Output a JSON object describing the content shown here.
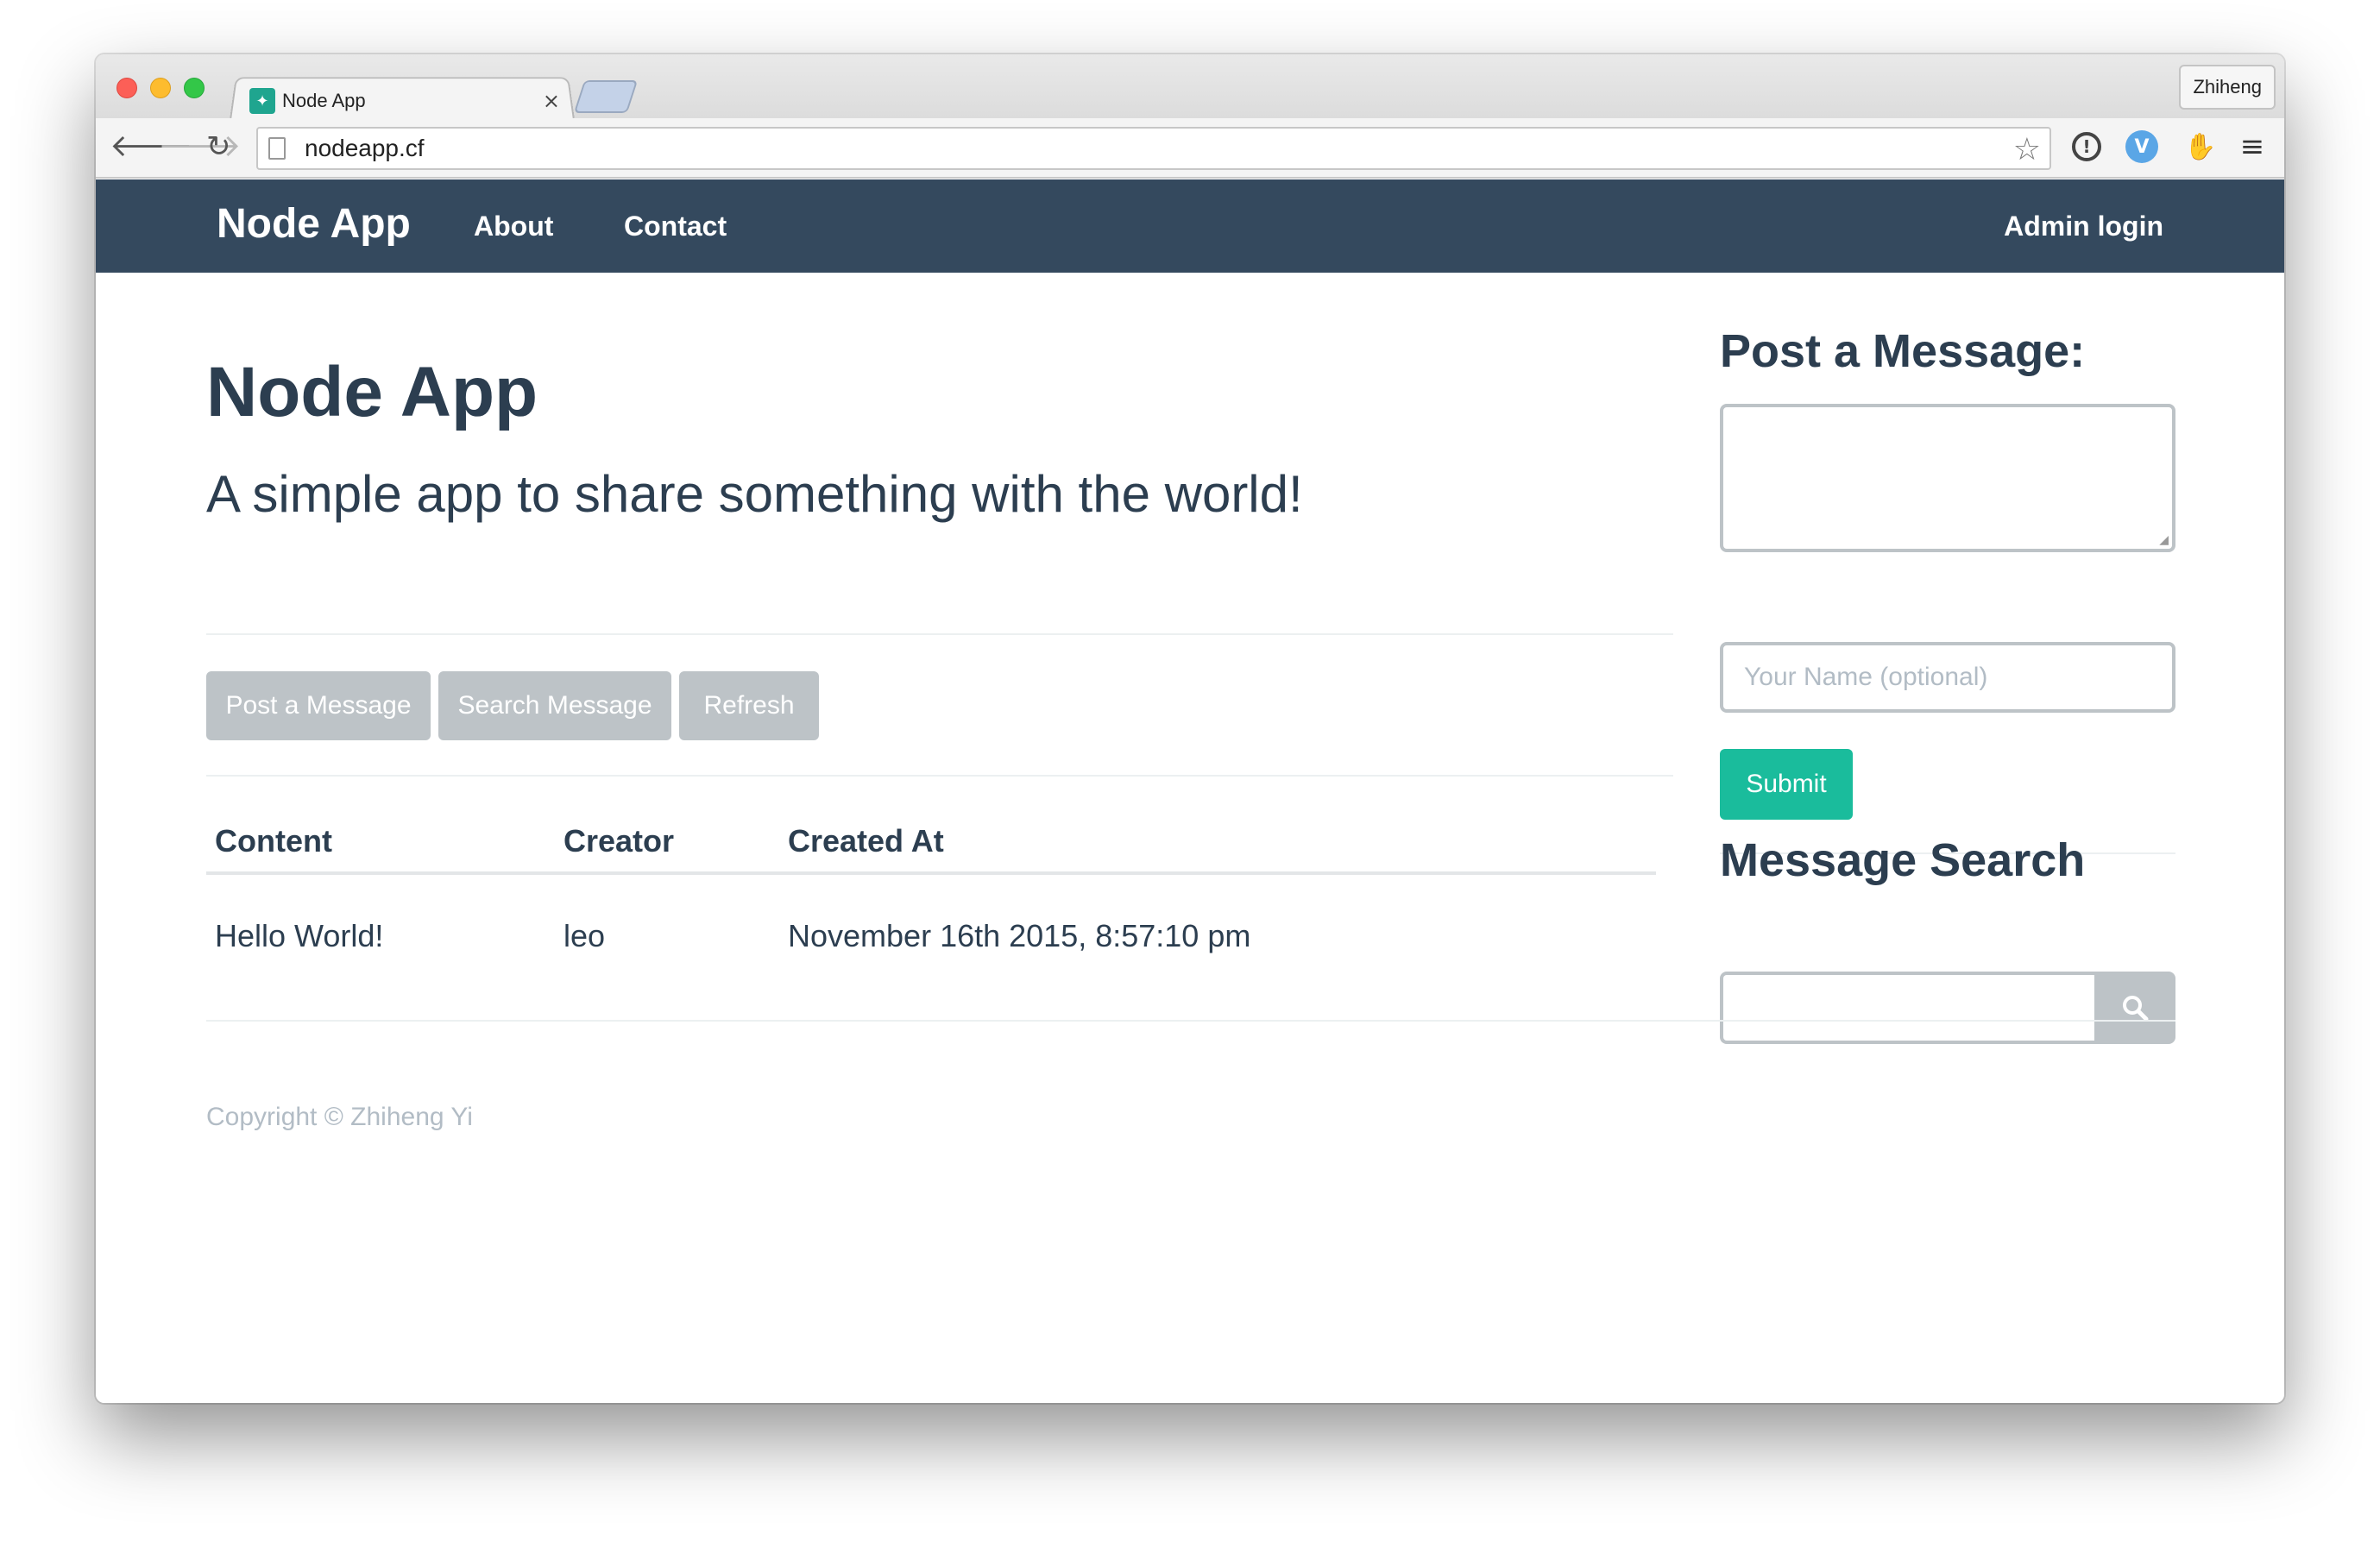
{
  "browser": {
    "tab_title": "Node App",
    "tab_close": "×",
    "profile_name": "Zhiheng",
    "url": "nodeapp.cf",
    "icons": {
      "back": "arrow-left-icon",
      "forward": "arrow-right-icon",
      "reload": "reload-icon",
      "star": "star-icon",
      "menu": "hamburger-menu-icon"
    }
  },
  "navbar": {
    "brand": "Node App",
    "links": {
      "about": "About",
      "contact": "Contact",
      "admin": "Admin login"
    },
    "background": "#34495e"
  },
  "main": {
    "title": "Node App",
    "tagline": "A simple app to share something with the world!",
    "buttons": {
      "post": "Post a Message",
      "search": "Search Message",
      "refresh": "Refresh"
    },
    "table": {
      "headers": [
        "Content",
        "Creator",
        "Created At"
      ],
      "rows": [
        [
          "Hello World!",
          "leo",
          "November 16th 2015, 8:57:10 pm"
        ]
      ]
    }
  },
  "sidebar": {
    "post_title": "Post a Message:",
    "message_placeholder": "",
    "name_placeholder": "Your Name (optional)",
    "submit_label": "Submit",
    "search_title": "Message Search",
    "accent_color": "#1abc9c"
  },
  "footer": {
    "copyright": "Copyright © Zhiheng Yi"
  }
}
